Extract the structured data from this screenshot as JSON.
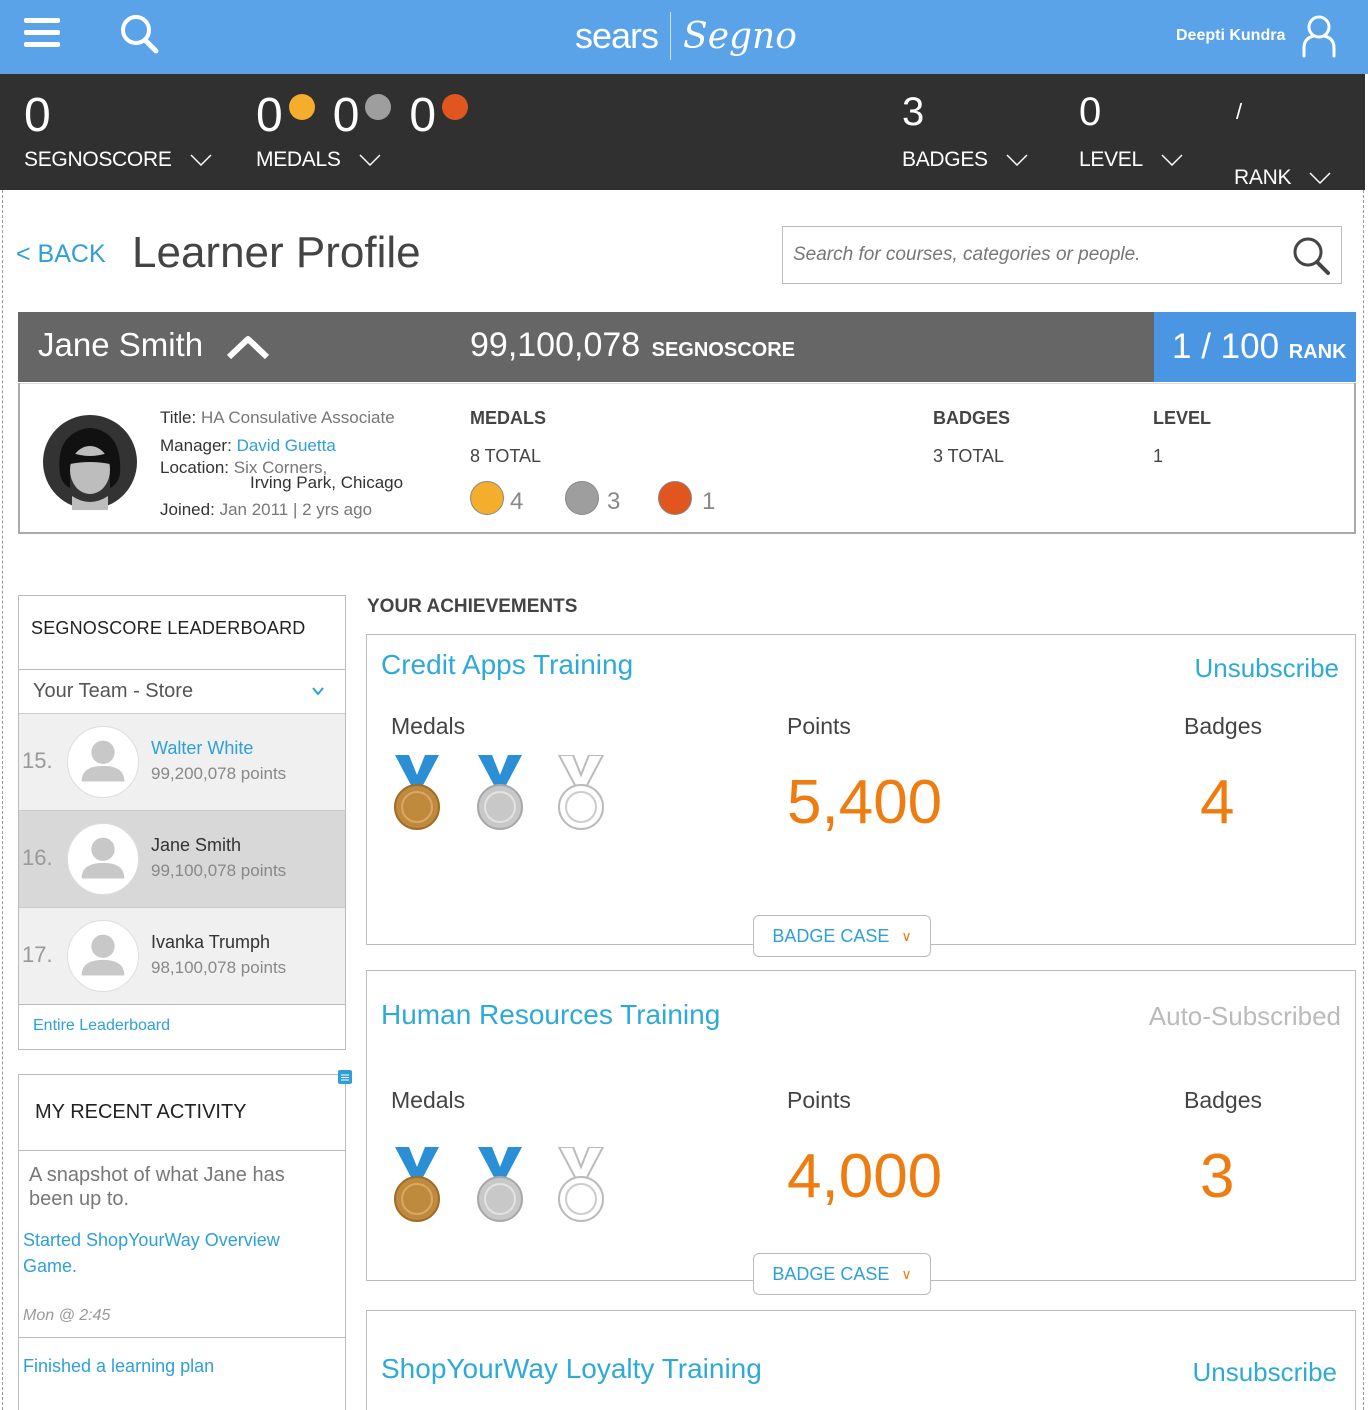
{
  "header": {
    "brand_left": "sears",
    "brand_right": "Segno",
    "user_name": "Deepti Kundra"
  },
  "stats": {
    "segnoscore": {
      "value": "0",
      "label": "SEGNOSCORE"
    },
    "medals": {
      "gold": "0",
      "silver": "0",
      "bronze": "0",
      "label": "MEDALS"
    },
    "badges": {
      "value": "3",
      "label": "BADGES"
    },
    "level": {
      "value": "0",
      "label": "LEVEL"
    },
    "rank": {
      "value": "/",
      "label": "RANK"
    }
  },
  "colors": {
    "gold": "#f5ad2c",
    "silver": "#9e9e9e",
    "bronze": "#e0561e",
    "accent": "#2f9fd8",
    "orange": "#ee7d11"
  },
  "page": {
    "back_label": "< BACK",
    "title": "Learner Profile",
    "search_placeholder": "Search for courses, categories or people."
  },
  "profile": {
    "name": "Jane Smith",
    "score": "99,100,078",
    "score_label": "SEGNOSCORE",
    "rank": "1 / 100",
    "rank_label": "RANK",
    "title_label": "Title:",
    "title_value": "HA Consulative Associate",
    "manager_label": "Manager:",
    "manager_value": "David Guetta",
    "location_label": "Location:",
    "location_value_1": "Six Corners,",
    "location_value_2": "Irving Park, Chicago",
    "joined_label": "Joined:",
    "joined_value": "Jan 2011 | 2 yrs ago",
    "medals_head": "MEDALS",
    "medals_total": "8 TOTAL",
    "medal_gold": "4",
    "medal_silver": "3",
    "medal_bronze": "1",
    "badges_head": "BADGES",
    "badges_total": "3 TOTAL",
    "level_head": "LEVEL",
    "level_value": "1"
  },
  "leaderboard": {
    "title": "SEGNOSCORE LEADERBOARD",
    "filter": "Your Team - Store",
    "rows": [
      {
        "pos": "15.",
        "name": "Walter White",
        "points": "99,200,078 points"
      },
      {
        "pos": "16.",
        "name": "Jane Smith",
        "points": "99,100,078 points"
      },
      {
        "pos": "17.",
        "name": "Ivanka Trumph",
        "points": "98,100,078 points"
      }
    ],
    "link": "Entire Leaderboard"
  },
  "activity": {
    "title": "MY RECENT ACTIVITY",
    "desc": "A snapshot of what Jane has been up to.",
    "item1": "Started ShopYourWay Overview Game.",
    "item1_time": "Mon @ 2:45",
    "item2": "Finished a learning plan"
  },
  "achievements": {
    "heading": "YOUR ACHIEVEMENTS",
    "medals_label": "Medals",
    "points_label": "Points",
    "badges_label": "Badges",
    "badge_case": "BADGE CASE",
    "cards": [
      {
        "title": "Credit Apps Training",
        "action": "Unsubscribe",
        "points": "5,400",
        "badges": "4"
      },
      {
        "title": "Human Resources Training",
        "action": "Auto-Subscribed",
        "points": "4,000",
        "badges": "3"
      },
      {
        "title": "ShopYourWay Loyalty Training",
        "action": "Unsubscribe"
      }
    ]
  }
}
